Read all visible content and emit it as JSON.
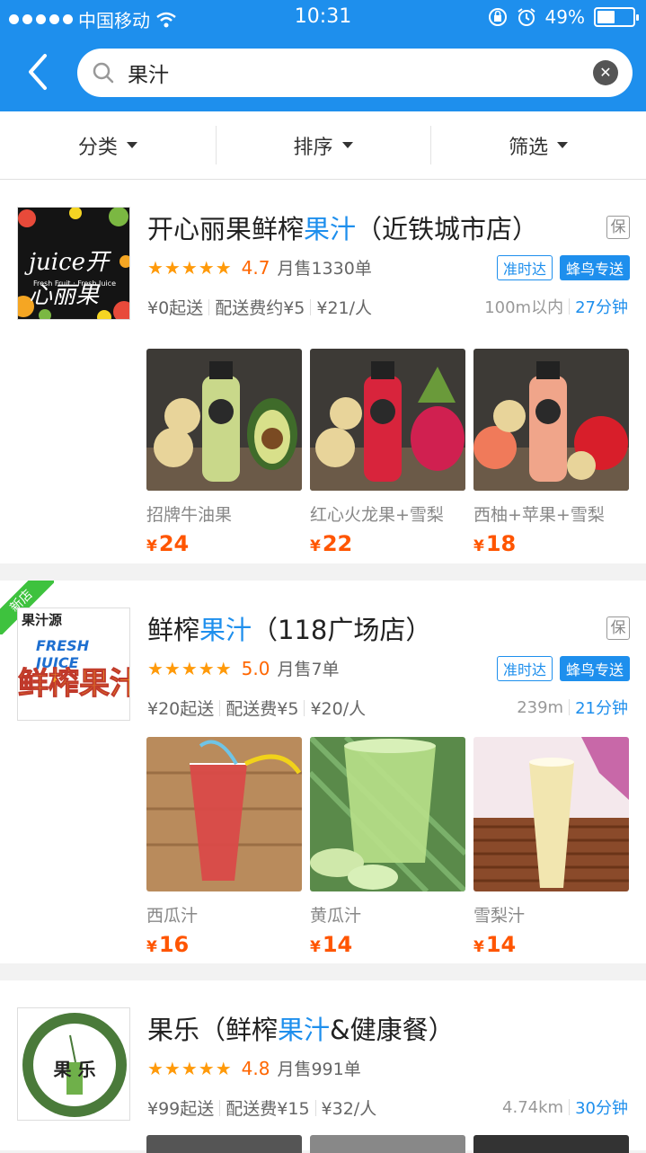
{
  "status": {
    "carrier": "中国移动",
    "time": "10:31",
    "battery": "49%",
    "battery_level": 0.49
  },
  "search": {
    "query": "果汁"
  },
  "filters": [
    "分类",
    "排序",
    "筛选"
  ],
  "shops": [
    {
      "name_before": "开心丽果鲜榨",
      "name_highlight": "果汁",
      "name_after": "（近铁城市店）",
      "logo_text": "juice开心丽果",
      "logo_sub": "Fresh Fruit · Fresh Juice",
      "bao": "保",
      "rating": "4.7",
      "stars": 4.7,
      "sales": "月售1330单",
      "tag_ontime": "准时达",
      "tag_delivery": "蜂鸟专送",
      "min_order": "¥0起送",
      "delivery_fee": "配送费约¥5",
      "per_person": "¥21/人",
      "distance": "100m以内",
      "eta": "27分钟",
      "products": [
        {
          "name": "招牌牛油果",
          "price": "24",
          "color": "#c9d88a"
        },
        {
          "name": "红心火龙果+雪梨",
          "price": "22",
          "color": "#d8243c"
        },
        {
          "name": "西柚+苹果+雪梨",
          "price": "18",
          "color": "#f0a58a"
        }
      ]
    },
    {
      "name_before": "鲜榨",
      "name_highlight": "果汁",
      "name_after": "（118广场店）",
      "logo_text": "鲜榨果汁",
      "logo_sub": "FRESH JUICE",
      "logo_top": "果汁源",
      "new_label": "新店",
      "bao": "保",
      "rating": "5.0",
      "stars": 5.0,
      "sales": "月售7单",
      "tag_ontime": "准时达",
      "tag_delivery": "蜂鸟专送",
      "min_order": "¥20起送",
      "delivery_fee": "配送费¥5",
      "per_person": "¥20/人",
      "distance": "239m",
      "eta": "21分钟",
      "products": [
        {
          "name": "西瓜汁",
          "price": "16",
          "color": "#d94a48"
        },
        {
          "name": "黄瓜汁",
          "price": "14",
          "color": "#9ccc6a"
        },
        {
          "name": "雪梨汁",
          "price": "14",
          "color": "#f2e6b0"
        }
      ]
    },
    {
      "name_before": "果乐（鲜榨",
      "name_highlight": "果汁",
      "name_after": "&健康餐）",
      "logo_text": "果  乐",
      "rating": "4.8",
      "stars": 4.8,
      "sales": "月售991单",
      "min_order": "¥99起送",
      "delivery_fee": "配送费¥15",
      "per_person": "¥32/人",
      "distance": "4.74km",
      "eta": "30分钟"
    }
  ]
}
